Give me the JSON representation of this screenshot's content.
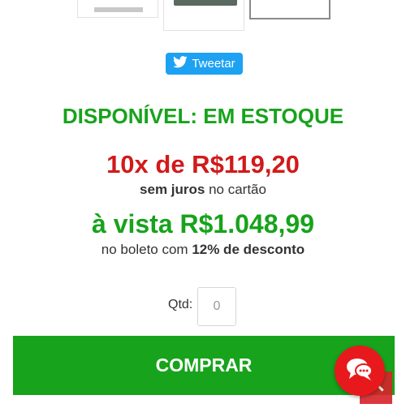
{
  "gallery": {
    "thumbnails": [
      "thumb-1",
      "thumb-2",
      "thumb-3"
    ]
  },
  "share": {
    "tweet_label": "Tweetar",
    "icon": "twitter-bird-icon"
  },
  "availability": {
    "text": "DISPONÍVEL: EM ESTOQUE"
  },
  "pricing": {
    "installments": "10x de R$119,20",
    "interest_bold": "sem juros",
    "interest_rest": " no cartão",
    "cash_price": "à vista R$1.048,99",
    "boleto_prefix": "no boleto com ",
    "boleto_discount": "12% de desconto"
  },
  "purchase": {
    "qty_label": "Qtd:",
    "qty_placeholder": "0",
    "buy_label": "COMPRAR"
  },
  "widgets": {
    "chat_icon": "chat-bubbles-icon",
    "scroll_icon": "chevron-up-icon"
  },
  "colors": {
    "green": "#17a31b",
    "red": "#d11a1a",
    "twitter_blue": "#1da1f2",
    "chat_red": "#e8191d"
  }
}
